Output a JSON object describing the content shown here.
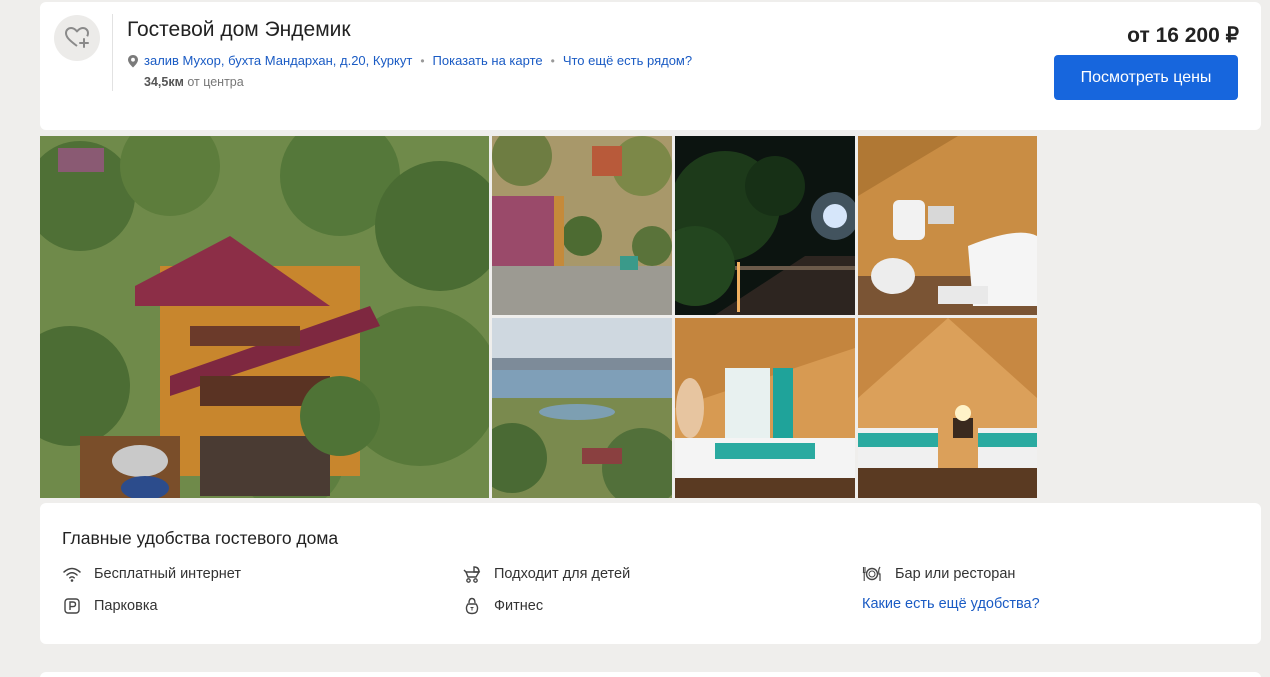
{
  "hotel": {
    "name": "Гостевой дом Эндемик",
    "address": "залив Мухор, бухта Мандархан, д.20, Куркут",
    "show_on_map": "Показать на карте",
    "whats_nearby": "Что ещё есть рядом?",
    "distance_value": "34,5км",
    "distance_suffix": " от центра",
    "price": "от 16 200 ₽",
    "view_prices_button": "Посмотреть цены",
    "favorite_icon": "heart-plus-icon"
  },
  "photos": [
    {
      "name": "photo-main-exterior",
      "subject": "aerial view of wooden guest house among pine trees"
    },
    {
      "name": "photo-aerial-roof",
      "subject": "top-down aerial view of red roof and yard"
    },
    {
      "name": "photo-night-terrace",
      "subject": "terrace at night with lamp"
    },
    {
      "name": "photo-bathroom",
      "subject": "wooden bathroom with bathtub and toilet"
    },
    {
      "name": "photo-lake-view",
      "subject": "view of bay and lake"
    },
    {
      "name": "photo-bedroom-double",
      "subject": "attic bedroom with double bed"
    },
    {
      "name": "photo-bedroom-twin",
      "subject": "attic bedroom with twin beds"
    }
  ],
  "amenities": {
    "title": "Главные удобства гостевого дома",
    "items": [
      {
        "label": "Бесплатный интернет",
        "icon": "wifi-icon"
      },
      {
        "label": "Подходит для детей",
        "icon": "stroller-icon"
      },
      {
        "label": "Бар или ресторан",
        "icon": "restaurant-icon"
      },
      {
        "label": "Парковка",
        "icon": "parking-icon"
      },
      {
        "label": "Фитнес",
        "icon": "kettlebell-icon"
      }
    ],
    "more_link": "Какие есть ещё удобства?"
  },
  "colors": {
    "accent": "#1766dd",
    "link": "#1a5bc4",
    "page_bg": "#efeeec"
  }
}
